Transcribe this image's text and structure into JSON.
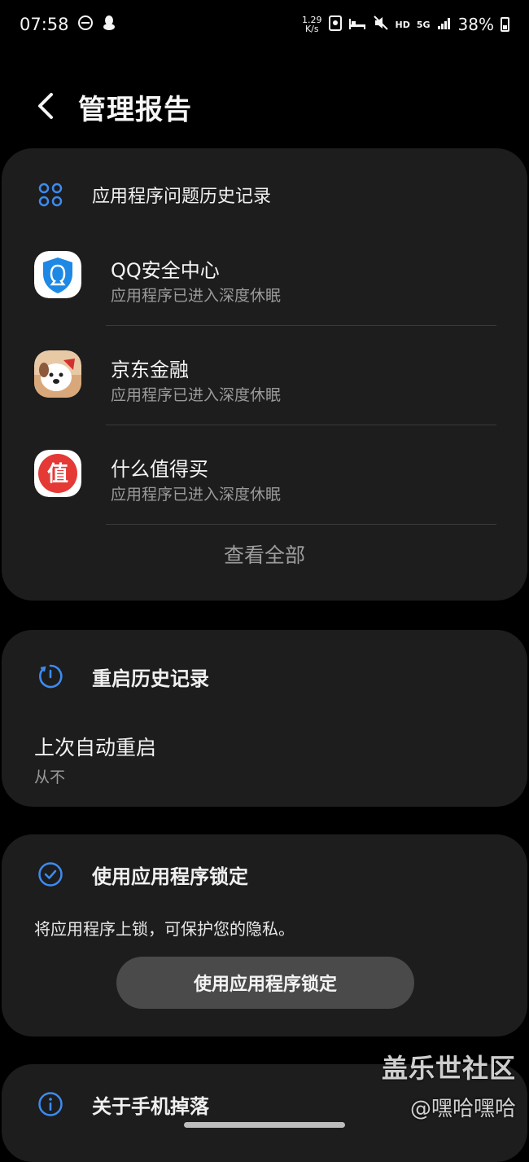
{
  "status_bar": {
    "time": "07:58",
    "speed_value": "1.29",
    "speed_unit": "K/s",
    "hd_label": "HD",
    "network_label": "5G",
    "battery_percent": "38%"
  },
  "header": {
    "title": "管理报告"
  },
  "app_issues": {
    "title": "应用程序问题历史记录",
    "apps": [
      {
        "name": "QQ安全中心",
        "status": "应用程序已进入深度休眠",
        "icon": "qq-security-icon"
      },
      {
        "name": "京东金融",
        "status": "应用程序已进入深度休眠",
        "icon": "jd-finance-icon"
      },
      {
        "name": "什么值得买",
        "status": "应用程序已进入深度休眠",
        "icon": "smzdm-icon"
      }
    ],
    "view_all": "查看全部",
    "smzdm_char": "值"
  },
  "restart_history": {
    "title": "重启历史记录",
    "last_restart_label": "上次自动重启",
    "last_restart_value": "从不"
  },
  "app_lock": {
    "title": "使用应用程序锁定",
    "description": "将应用程序上锁，可保护您的隐私。",
    "button_label": "使用应用程序锁定"
  },
  "drop_detection": {
    "title": "关于手机掉落"
  },
  "watermark": {
    "line1": "盖乐世社区",
    "line2": "@嘿哈嘿哈"
  },
  "colors": {
    "background": "#000000",
    "card": "#1d1d1d",
    "accent_blue": "#3d8bf0",
    "secondary_text": "#9a9a9a",
    "button": "#4a4a4a"
  }
}
